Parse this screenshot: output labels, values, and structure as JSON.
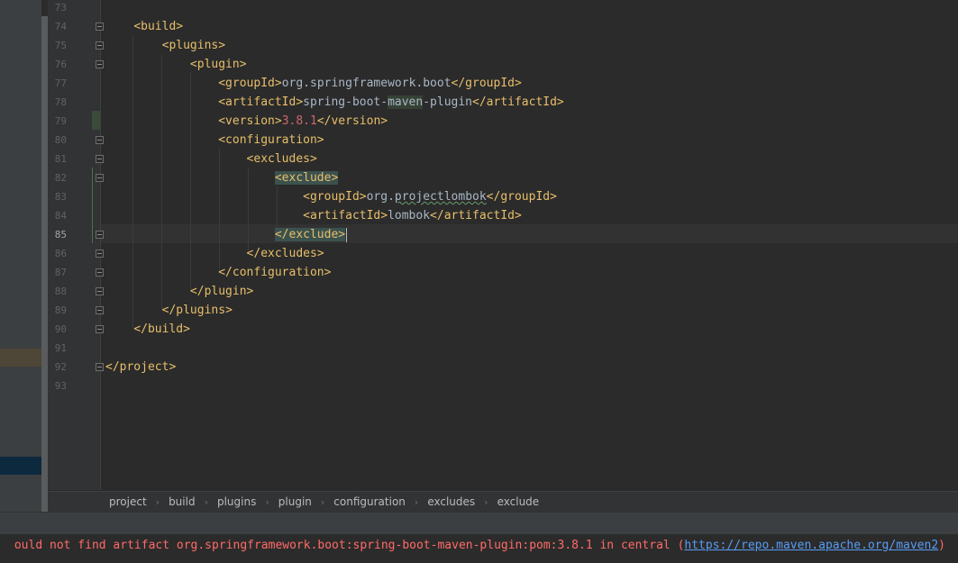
{
  "editor": {
    "current_line": "85",
    "lines": [
      {
        "num": "73"
      },
      {
        "num": "74",
        "tag": "<build>"
      },
      {
        "num": "75",
        "tag": "<plugins>"
      },
      {
        "num": "76",
        "tag": "<plugin>"
      },
      {
        "num": "77",
        "open": "<groupId>",
        "text": "org.springframework.boot",
        "close": "</groupId>"
      },
      {
        "num": "78",
        "open": "<artifactId>",
        "text_a": "spring-boot-",
        "text_b": "maven",
        "text_c": "-plugin",
        "close": "</artifactId>"
      },
      {
        "num": "79",
        "open": "<version>",
        "text": "3.8.1",
        "close": "</version>"
      },
      {
        "num": "80",
        "tag": "<configuration>"
      },
      {
        "num": "81",
        "tag": "<excludes>"
      },
      {
        "num": "82",
        "tag": "<exclude>"
      },
      {
        "num": "83",
        "open": "<groupId>",
        "text_a": "org.",
        "text_b": "projectlombok",
        "close": "</groupId>"
      },
      {
        "num": "84",
        "open": "<artifactId>",
        "text": "lombok",
        "close": "</artifactId>"
      },
      {
        "num": "85",
        "tag_a": "</exclude",
        "tag_b": ">"
      },
      {
        "num": "86",
        "tag": "</excludes>"
      },
      {
        "num": "87",
        "tag": "</configuration>"
      },
      {
        "num": "88",
        "tag": "</plugin>"
      },
      {
        "num": "89",
        "tag": "</plugins>"
      },
      {
        "num": "90",
        "tag": "</build>"
      },
      {
        "num": "91"
      },
      {
        "num": "92",
        "tag": "</project>"
      },
      {
        "num": "93"
      }
    ]
  },
  "breadcrumb": [
    "project",
    "build",
    "plugins",
    "plugin",
    "configuration",
    "excludes",
    "exclude"
  ],
  "status": {
    "message": "ould not find artifact org.springframework.boot:spring-boot-maven-plugin:pom:3.8.1 in central (",
    "link": "https://repo.maven.apache.org/maven2",
    "suffix": ")"
  },
  "colors": {
    "background": "#2b2b2b",
    "tag": "#e8bf6a",
    "text": "#a9b7c6",
    "error": "#ff6b68",
    "link": "#589df6"
  },
  "icons": {
    "fold_marker": "fold-marker-icon",
    "breadcrumb_separator": "chevron-right-icon"
  }
}
